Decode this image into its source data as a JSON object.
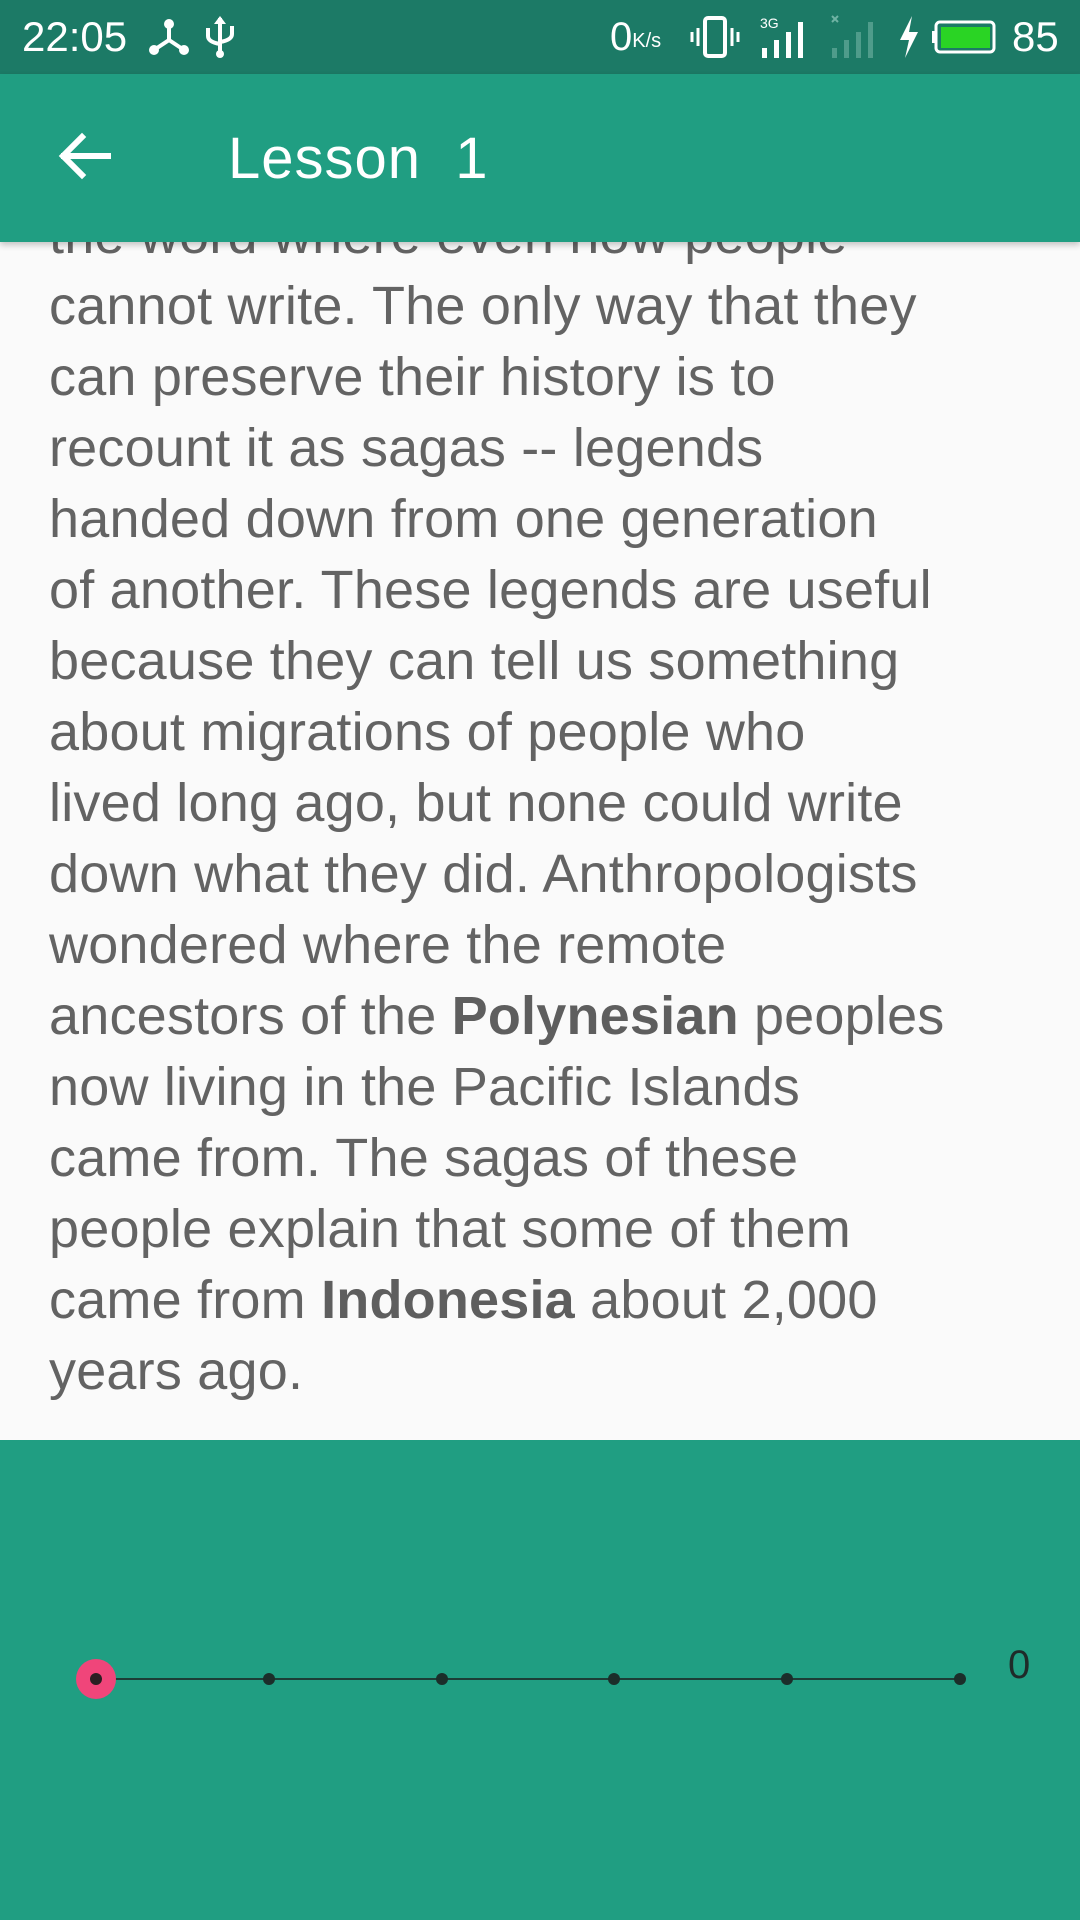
{
  "status_bar": {
    "time": "22:05",
    "network_speed_value": "0",
    "network_speed_unit": "K/s",
    "network_type": "3G",
    "battery_percent": "85",
    "icons": [
      "share-icon",
      "usb-icon",
      "vibrate-icon",
      "signal-icon",
      "signal-weak-icon",
      "charging-icon",
      "battery-icon"
    ]
  },
  "app_bar": {
    "back_icon": "arrow-left-icon",
    "title": "Lesson  1"
  },
  "lesson": {
    "lines": [
      [
        {
          "t": "the word where even now people"
        }
      ],
      [
        {
          "t": "cannot write. The only way that they"
        }
      ],
      [
        {
          "t": "can preserve their history is to"
        }
      ],
      [
        {
          "t": "recount it as sagas -- legends"
        }
      ],
      [
        {
          "t": "handed down from one generation"
        }
      ],
      [
        {
          "t": "of another. These legends are useful"
        }
      ],
      [
        {
          "t": "because they can tell us something"
        }
      ],
      [
        {
          "t": "about migrations of people who"
        }
      ],
      [
        {
          "t": "lived long ago, but none could write"
        }
      ],
      [
        {
          "t": "down what they did. Anthropologists"
        }
      ],
      [
        {
          "t": "wondered where the remote"
        }
      ],
      [
        {
          "t": "ancestors of the "
        },
        {
          "t": "Polynesian",
          "b": true
        },
        {
          "t": " peoples"
        }
      ],
      [
        {
          "t": "now living in the Pacific Islands"
        }
      ],
      [
        {
          "t": "came from. The sagas of these"
        }
      ],
      [
        {
          "t": "people explain that some of them"
        }
      ],
      [
        {
          "t": "came from "
        },
        {
          "t": "Indonesia",
          "b": true
        },
        {
          "t": " about 2,000"
        }
      ],
      [
        {
          "t": "years ago."
        }
      ]
    ]
  },
  "player": {
    "slider_steps": 6,
    "slider_position": 0,
    "value_label": "0"
  },
  "colors": {
    "status_bar": "#1c7a66",
    "app_bar": "#209e82",
    "panel": "#209e82",
    "thumb": "#f0457a",
    "text": "#636363"
  }
}
